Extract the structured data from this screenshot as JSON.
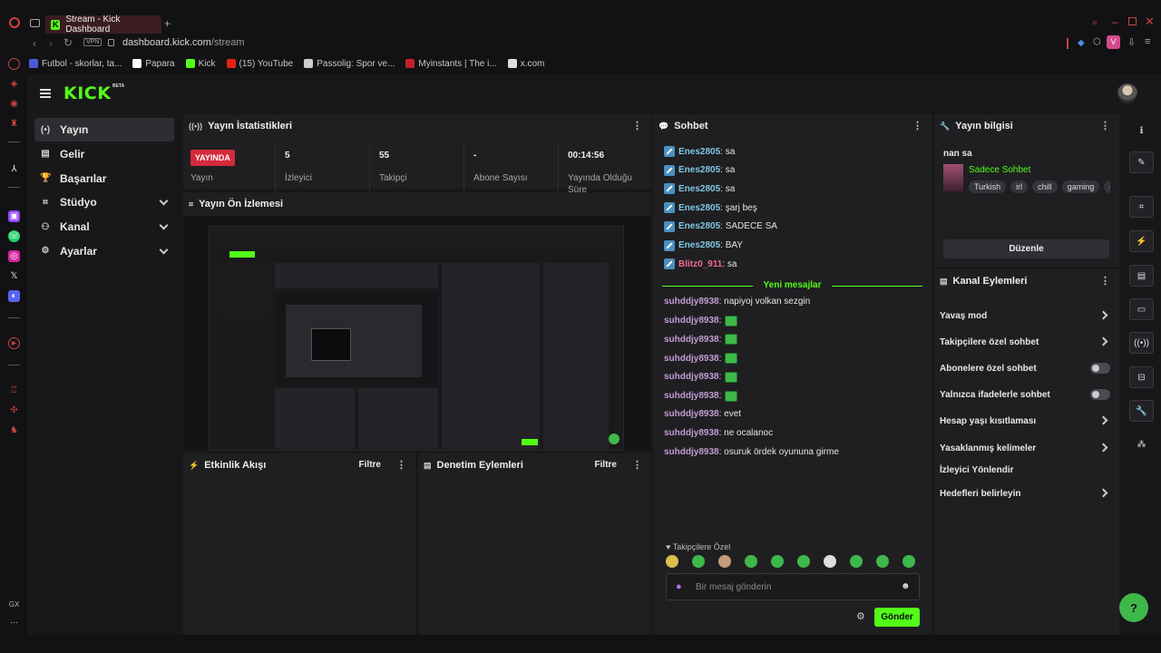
{
  "browser": {
    "tab_title": "Stream - Kick Dashboard",
    "url_host": "dashboard.kick.com",
    "url_path": "/stream",
    "vpn_label": "VPN",
    "profile_letter": "V",
    "bookmarks": [
      "Futbol - skorlar, ta...",
      "Papara",
      "Kick",
      "(15) YouTube",
      "Passolig: Spor ve...",
      "Myinstants | The i...",
      "x.com"
    ],
    "bookmark_colors": [
      "#4b5bd6",
      "#ffffff",
      "#53fc18",
      "#e62117",
      "#cccccc",
      "#c4202a",
      "#dddddd"
    ],
    "gx_label": "GX",
    "more_label": "..."
  },
  "app": {
    "logo": "KICK",
    "beta": "BETA"
  },
  "sidebar": {
    "items": [
      {
        "label": "Yayın",
        "icon": "(•)",
        "expand": false
      },
      {
        "label": "Gelir",
        "icon": "▤",
        "expand": false
      },
      {
        "label": "Başarılar",
        "icon": "🏆",
        "expand": false
      },
      {
        "label": "Stüdyo",
        "icon": "⌗",
        "expand": true
      },
      {
        "label": "Kanal",
        "icon": "⚇",
        "expand": true
      },
      {
        "label": "Ayarlar",
        "icon": "⚙",
        "expand": true
      }
    ]
  },
  "stats": {
    "title": "Yayın İstatistikleri",
    "live_badge": "YAYINDA",
    "items": [
      {
        "value": "",
        "label": "Yayın"
      },
      {
        "value": "5",
        "label": "İzleyici"
      },
      {
        "value": "55",
        "label": "Takipçi"
      },
      {
        "value": "-",
        "label": "Abone Sayısı"
      },
      {
        "value": "00:14:56",
        "label": "Yayında Olduğu Süre"
      }
    ]
  },
  "preview": {
    "title": "Yayın Ön İzlemesi"
  },
  "activity": {
    "title": "Etkinlik Akışı",
    "filter": "Filtre"
  },
  "moderation": {
    "title": "Denetim Eylemleri",
    "filter": "Filtre"
  },
  "chat": {
    "title": "Sohbet",
    "messages": [
      {
        "user": "Enes2805",
        "text": ": sa",
        "color": "#7ec8e3",
        "mod": true,
        "emote": false
      },
      {
        "user": "Enes2805",
        "text": ": sa",
        "color": "#7ec8e3",
        "mod": true,
        "emote": false
      },
      {
        "user": "Enes2805",
        "text": ": sa",
        "color": "#7ec8e3",
        "mod": true,
        "emote": false
      },
      {
        "user": "Enes2805",
        "text": ": şarj beş",
        "color": "#7ec8e3",
        "mod": true,
        "emote": false
      },
      {
        "user": "Enes2805",
        "text": ": SADECE SA",
        "color": "#7ec8e3",
        "mod": true,
        "emote": false
      },
      {
        "user": "Enes2805",
        "text": ": BAY",
        "color": "#7ec8e3",
        "mod": true,
        "emote": false
      },
      {
        "user": "Blitz0_911",
        "text": ": sa",
        "color": "#ee6a8a",
        "mod": true,
        "emote": false
      }
    ],
    "new_messages": "Yeni mesajlar",
    "new": [
      {
        "user": "suhddjy8938",
        "text": ": napiyoj volkan sezgin",
        "emote": false
      },
      {
        "user": "suhddjy8938",
        "text": ":",
        "emote": true
      },
      {
        "user": "suhddjy8938",
        "text": ":",
        "emote": true
      },
      {
        "user": "suhddjy8938",
        "text": ":",
        "emote": true
      },
      {
        "user": "suhddjy8938",
        "text": ":",
        "emote": true
      },
      {
        "user": "suhddjy8938",
        "text": ":",
        "emote": true
      },
      {
        "user": "suhddjy8938",
        "text": ": evet",
        "emote": false
      },
      {
        "user": "suhddjy8938",
        "text": ": ne ocalanoc",
        "emote": false
      },
      {
        "user": "suhddjy8938",
        "text": ": osuruk ördek oyununa girme",
        "emote": false
      }
    ],
    "new_color": "#c39bd3",
    "followers_only": "Takipçilere Özel",
    "placeholder": "Bir mesaj gönderin",
    "send": "Gönder"
  },
  "info": {
    "title": "Yayın bilgisi",
    "stream_title": "nan sa",
    "category": "Sadece Sohbet",
    "tags": [
      "Turkish",
      "irl",
      "chill",
      "gaming",
      "cl"
    ],
    "edit": "Düzenle"
  },
  "channel_actions": {
    "title": "Kanal Eylemleri",
    "items": [
      {
        "label": "Yavaş mod",
        "type": "arrow"
      },
      {
        "label": "Takipçilere özel sohbet",
        "type": "arrow"
      },
      {
        "label": "Abonelere özel sohbet",
        "type": "toggle"
      },
      {
        "label": "Yalnızca ifadelerle sohbet",
        "type": "toggle"
      },
      {
        "label": "Hesap yaşı kısıtlaması",
        "type": "arrow"
      },
      {
        "label": "Yasaklanmış kelimeler",
        "type": "arrow"
      },
      {
        "label": "İzleyici Yönlendir",
        "type": "none"
      },
      {
        "label": "Hedefleri belirleyin",
        "type": "arrow"
      }
    ]
  }
}
